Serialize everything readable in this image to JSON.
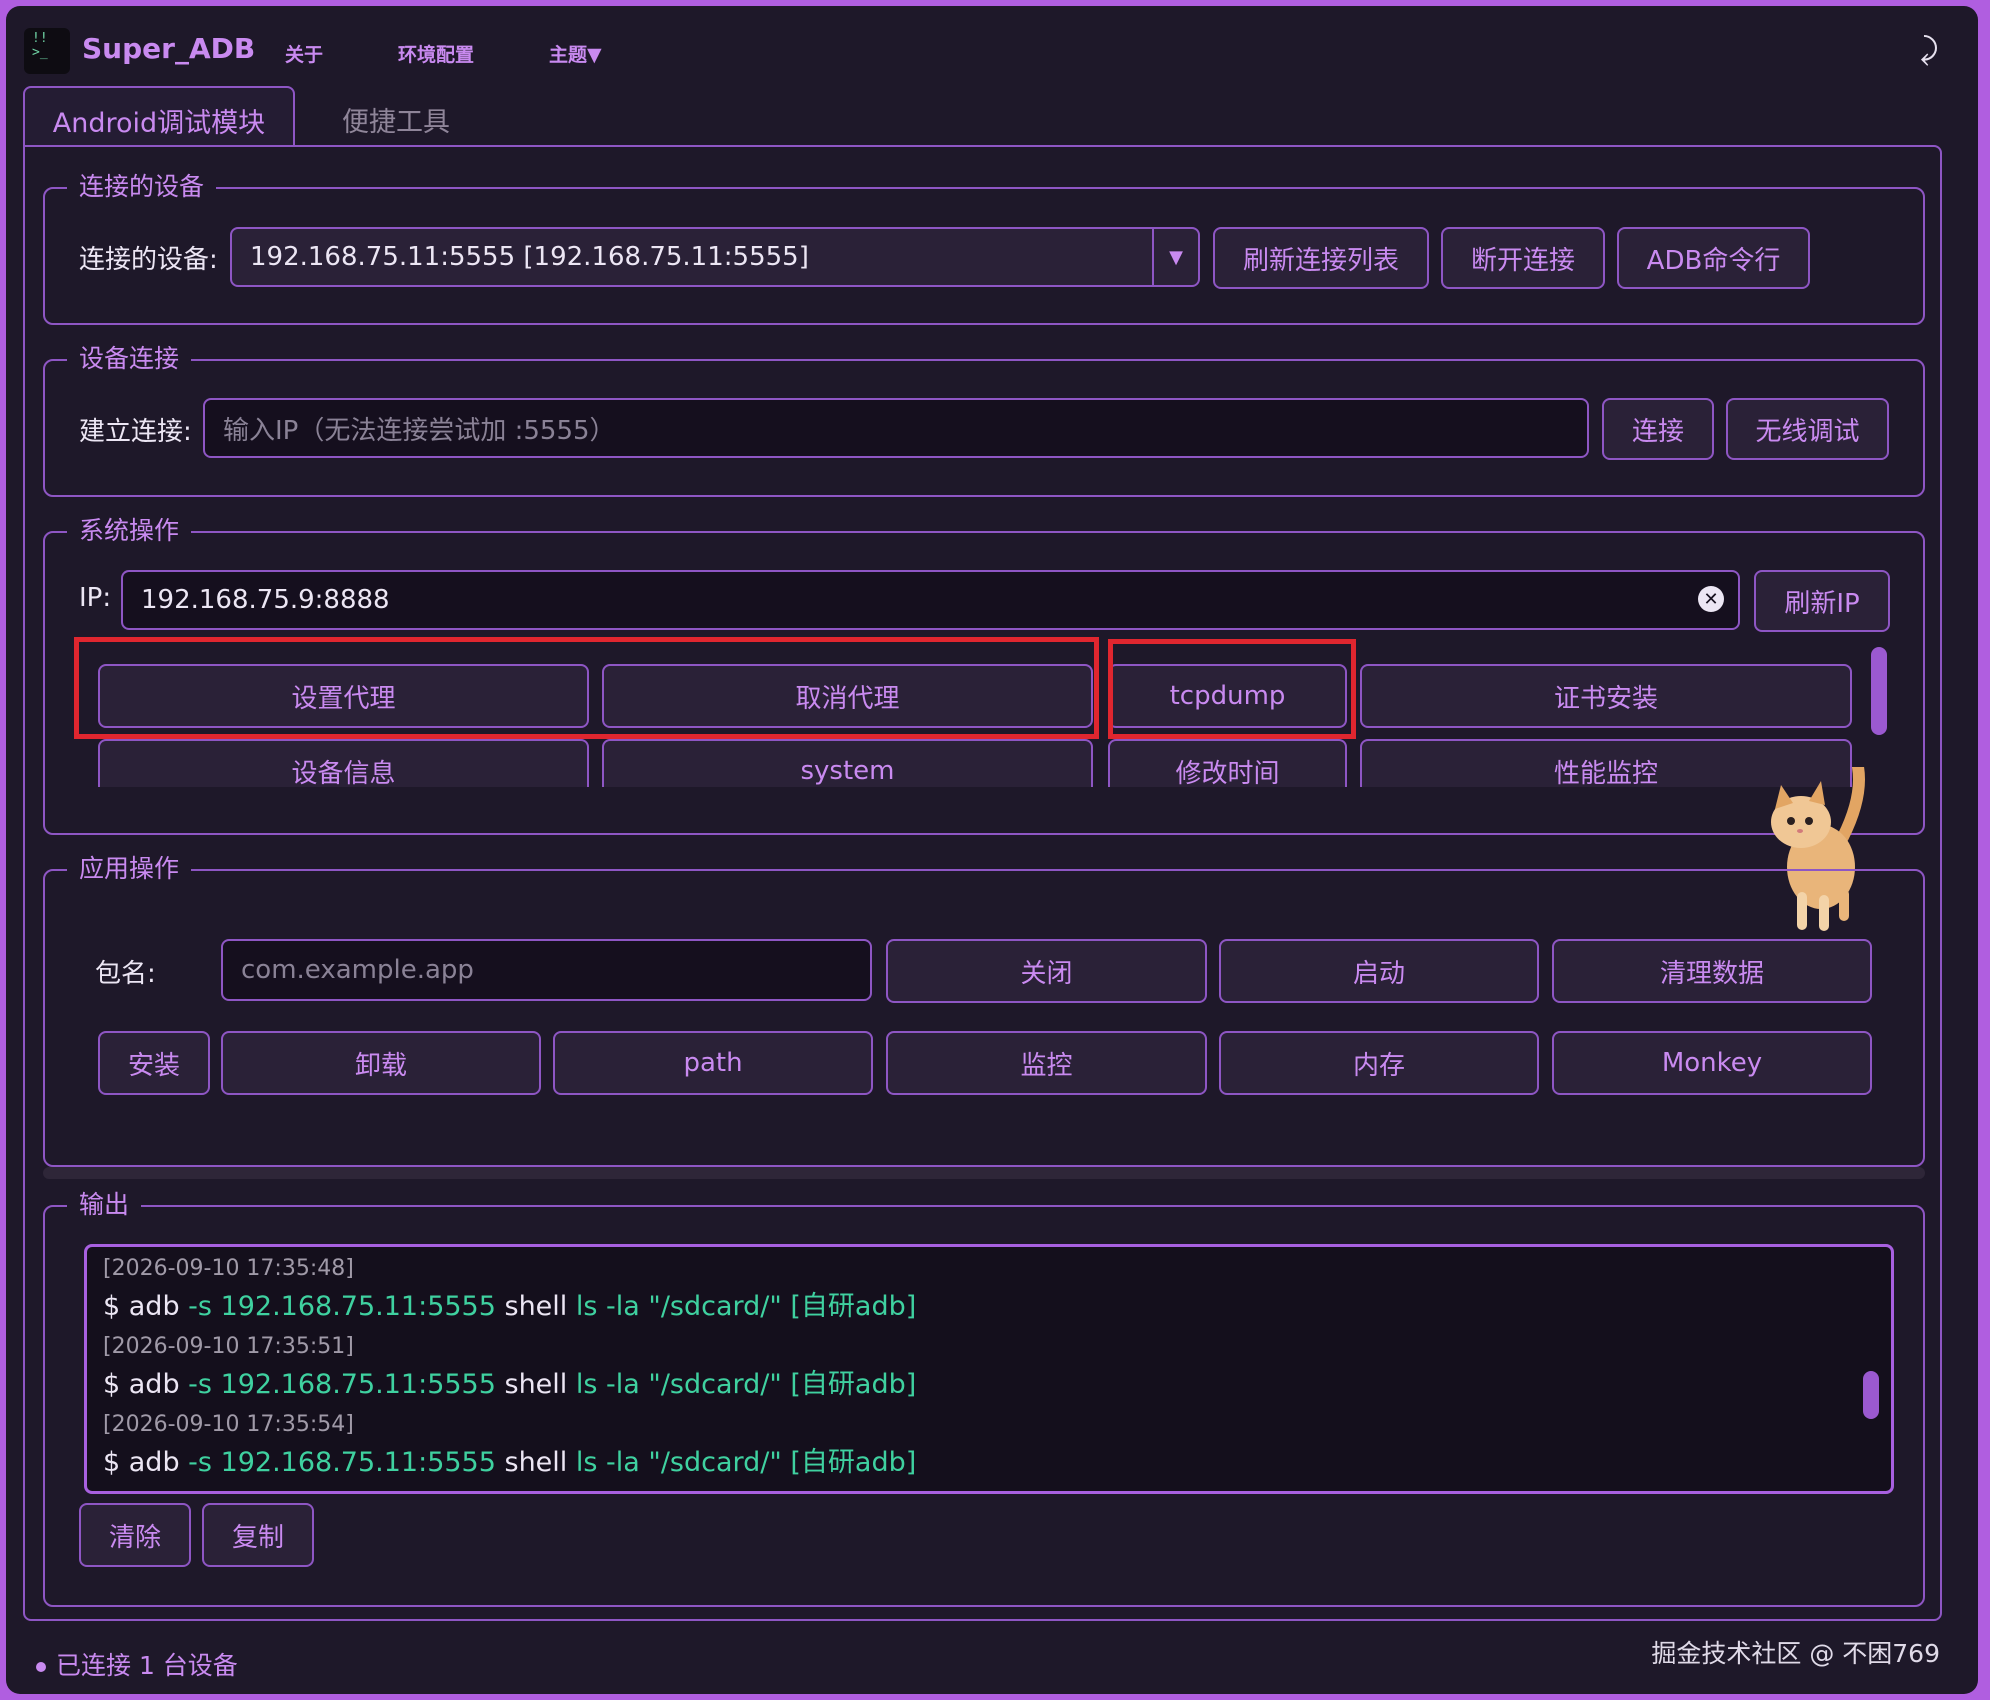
{
  "app": {
    "title": "Super_ADB",
    "menu": [
      "关于",
      "环境配置",
      "主题▼"
    ],
    "back_icon": "return-arrow-icon"
  },
  "tabs": [
    {
      "label": "Android调试模块",
      "active": true
    },
    {
      "label": "便捷工具",
      "active": false
    }
  ],
  "connected": {
    "group_title": "连接的设备",
    "label": "连接的设备:",
    "selected_device": "192.168.75.11:5555  [192.168.75.11:5555]",
    "refresh_label": "刷新连接列表",
    "disconnect_label": "断开连接",
    "adb_cli_label": "ADB命令行"
  },
  "device_connect": {
    "group_title": "设备连接",
    "label": "建立连接:",
    "placeholder": "输入IP（无法连接尝试加 :5555）",
    "connect_label": "连接",
    "wireless_label": "无线调试"
  },
  "system_ops": {
    "group_title": "系统操作",
    "ip_label": "IP:",
    "ip_value": "192.168.75.9:8888",
    "refresh_ip_label": "刷新IP",
    "row1": [
      "设置代理",
      "取消代理",
      "tcpdump",
      "证书安装"
    ],
    "row2": [
      "设备信息",
      "system",
      "修改时间",
      "性能监控"
    ]
  },
  "app_ops": {
    "group_title": "应用操作",
    "pkg_label": "包名:",
    "pkg_placeholder": "com.example.app",
    "row1": [
      "关闭",
      "启动",
      "清理数据"
    ],
    "row2": [
      "安装",
      "卸载",
      "path",
      "监控",
      "内存",
      "Monkey"
    ]
  },
  "output": {
    "group_title": "输出",
    "entries": [
      {
        "time": "[2026-09-10 17:35:48]",
        "prefix": "$ adb",
        "flag": " -s 192.168.75.11:5555 ",
        "shell": "shell",
        "cmd": " ls -la \"/sdcard/\" [自研adb]"
      },
      {
        "time": "[2026-09-10 17:35:51]",
        "prefix": "$ adb",
        "flag": " -s 192.168.75.11:5555 ",
        "shell": "shell",
        "cmd": " ls -la \"/sdcard/\" [自研adb]"
      },
      {
        "time": "[2026-09-10 17:35:54]",
        "prefix": "$ adb",
        "flag": " -s 192.168.75.11:5555 ",
        "shell": "shell",
        "cmd": " ls -la \"/sdcard/\" [自研adb]"
      }
    ],
    "clear_label": "清除",
    "copy_label": "复制"
  },
  "status": {
    "text": "已连接 1 台设备"
  },
  "watermark": "掘金技术社区 @ 不困769",
  "colors": {
    "accent": "#c98af0",
    "border": "#8e56c4",
    "background": "#1e1829",
    "highlight": "#e0262f",
    "terminal_green": "#3fd1a0"
  }
}
